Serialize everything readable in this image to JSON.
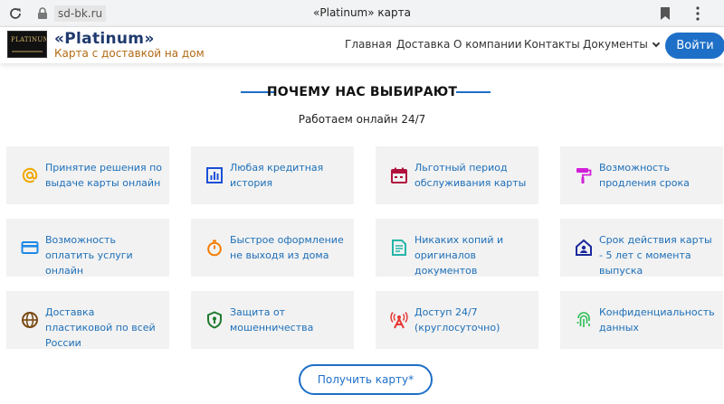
{
  "browser": {
    "url": "sd-bk.ru",
    "page_title": "«Platinum» карта"
  },
  "header": {
    "logo_text": "PLATINUM",
    "brand_name": "«Platinum»",
    "brand_subtitle": "Карта с доставкой на дом",
    "nav": [
      "Главная",
      "Доставка",
      "О компании",
      "Контакты",
      "Документы"
    ],
    "login_label": "Войти"
  },
  "section": {
    "title": "ПОЧЕМУ НАС ВЫБИРАЮТ",
    "subtitle": "Работаем онлайн 24/7"
  },
  "features": [
    {
      "text": "Принятие решения по выдаче карты онлайн",
      "icon": "at-icon",
      "color": "#f0a800"
    },
    {
      "text": "Любая кредитная история",
      "icon": "bar-chart-icon",
      "color": "#1b4fd8"
    },
    {
      "text": "Льготный период обслуживания карты",
      "icon": "calendar-icon",
      "color": "#b0123e"
    },
    {
      "text": "Возможность продления срока",
      "icon": "paint-roller-icon",
      "color": "#d11ed8"
    },
    {
      "text": "Возможность оплатить услуги онлайн",
      "icon": "credit-card-icon",
      "color": "#1e88e5"
    },
    {
      "text": "Быстрое оформление не выходя из дома",
      "icon": "stopwatch-icon",
      "color": "#f57c00"
    },
    {
      "text": "Никаких копий и оригиналов документов",
      "icon": "document-icon",
      "color": "#26b5a8"
    },
    {
      "text": "Срок действия карты - 5 лет с момента выпуска",
      "icon": "home-account-icon",
      "color": "#1a2a9c"
    },
    {
      "text": "Доставка пластиковой по всей России",
      "icon": "globe-icon",
      "color": "#7a4a14"
    },
    {
      "text": "Защита от мошенничества",
      "icon": "shield-lock-icon",
      "color": "#1f7a2e"
    },
    {
      "text": "Доступ 24/7 (круглосуточно)",
      "icon": "antenna-icon",
      "color": "#e53935"
    },
    {
      "text": "Конфиденциальность данных",
      "icon": "fingerprint-icon",
      "color": "#2ebf55"
    }
  ],
  "cta_label": "Получить карту*"
}
